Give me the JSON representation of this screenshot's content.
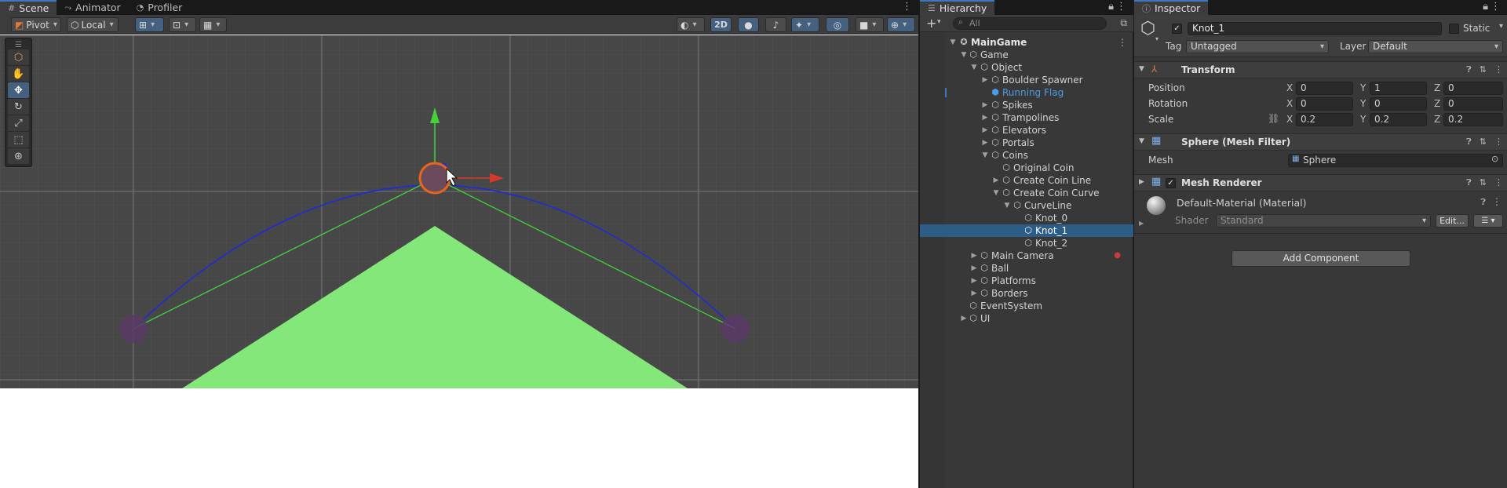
{
  "scene": {
    "tabs": [
      {
        "label": "Scene",
        "icon": "#"
      },
      {
        "label": "Animator",
        "icon": "⤳"
      },
      {
        "label": "Profiler",
        "icon": "◔"
      }
    ],
    "toolbar": {
      "pivot": "Pivot",
      "local": "Local",
      "twod": "2D"
    }
  },
  "hierarchy": {
    "tab": "Hierarchy",
    "search_placeholder": "All",
    "rows": [
      {
        "label": "MainGame"
      },
      {
        "label": "Game"
      },
      {
        "label": "Object"
      },
      {
        "label": "Boulder Spawner"
      },
      {
        "label": "Running Flag"
      },
      {
        "label": "Spikes"
      },
      {
        "label": "Trampolines"
      },
      {
        "label": "Elevators"
      },
      {
        "label": "Portals"
      },
      {
        "label": "Coins"
      },
      {
        "label": "Original Coin"
      },
      {
        "label": "Create Coin Line"
      },
      {
        "label": "Create Coin Curve"
      },
      {
        "label": "CurveLine"
      },
      {
        "label": "Knot_0"
      },
      {
        "label": "Knot_1"
      },
      {
        "label": "Knot_2"
      },
      {
        "label": "Main Camera"
      },
      {
        "label": "Ball"
      },
      {
        "label": "Platforms"
      },
      {
        "label": "Borders"
      },
      {
        "label": "EventSystem"
      },
      {
        "label": "UI"
      }
    ]
  },
  "inspector": {
    "tab": "Inspector",
    "object_name": "Knot_1",
    "static_label": "Static",
    "tag_label": "Tag",
    "tag_value": "Untagged",
    "layer_label": "Layer",
    "layer_value": "Default",
    "transform": {
      "title": "Transform",
      "position_label": "Position",
      "rotation_label": "Rotation",
      "scale_label": "Scale",
      "position": {
        "x": "0",
        "y": "1",
        "z": "0"
      },
      "rotation": {
        "x": "0",
        "y": "0",
        "z": "0"
      },
      "scale": {
        "x": "0.2",
        "y": "0.2",
        "z": "0.2"
      },
      "axis_x": "X",
      "axis_y": "Y",
      "axis_z": "Z"
    },
    "mesh_filter": {
      "title": "Sphere (Mesh Filter)",
      "mesh_label": "Mesh",
      "mesh_value": "Sphere"
    },
    "mesh_renderer": {
      "title": "Mesh Renderer",
      "material": "Default-Material (Material)",
      "shader_label": "Shader",
      "shader_value": "Standard",
      "edit_label": "Edit..."
    },
    "add_component": "Add Component"
  },
  "colors": {
    "accent_blue": "#3a79bb",
    "selection": "#2c5d87",
    "curve": "#1f2bd6",
    "guides": "#3cd23c",
    "triangle": "#84e77a",
    "handle": "#e8651c"
  }
}
